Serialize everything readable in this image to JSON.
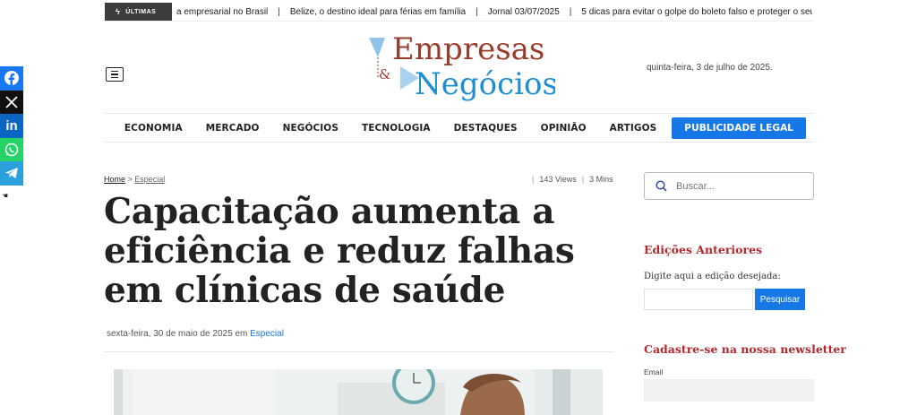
{
  "ticker": {
    "label": "ÚLTIMAS",
    "items": [
      "a empresarial no Brasil",
      "Belize, o destino ideal para férias em família",
      "Jornal 03/07/2025",
      "5 dicas para evitar o golpe do boleto falso e proteger o seu dinh"
    ]
  },
  "share": [
    "facebook-icon",
    "x-icon",
    "linkedin-icon",
    "whatsapp-icon",
    "telegram-icon"
  ],
  "header": {
    "logo_top": "Empresas",
    "logo_amp": "&",
    "logo_bottom": "Negócios",
    "date": "quinta-feira, 3 de julho de 2025."
  },
  "nav": {
    "items": [
      "ECONOMIA",
      "MERCADO",
      "NEGÓCIOS",
      "TECNOLOGIA",
      "DESTAQUES",
      "OPINIÃO",
      "ARTIGOS"
    ],
    "cta": "PUBLICIDADE LEGAL"
  },
  "article": {
    "breadcrumb_home": "Home",
    "breadcrumb_sep": " > ",
    "breadcrumb_section": "Especial",
    "views": "143 Views",
    "read_time": "3 Mins",
    "title": "Capacitação aumenta a eficiência e reduz falhas em clínicas de saúde",
    "date": "sexta-feira, 30 de maio de 2025",
    "in_word": "em",
    "category": "Especial"
  },
  "sidebar": {
    "search_placeholder": "Buscar...",
    "editions_title": "Edições Anteriores",
    "editions_label": "Digite aqui a edição desejada:",
    "editions_button": "Pesquisar",
    "newsletter_title": "Cadastre-se na nossa newsletter",
    "email_label": "Email"
  },
  "colors": {
    "accent": "#1677e6",
    "brand_red": "#b5272d",
    "logo_brown": "#9b3b2c",
    "logo_blue": "#1d8fd1"
  }
}
